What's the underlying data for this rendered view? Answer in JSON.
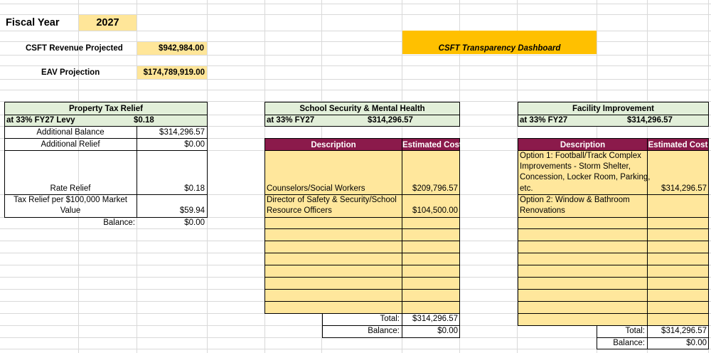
{
  "header": {
    "fiscal_year_label": "Fiscal Year",
    "fiscal_year_value": "2027",
    "revenue_label": "CSFT Revenue Projected",
    "revenue_value": "$942,984.00",
    "eav_label": "EAV Projection",
    "eav_value": "$174,789,919.00",
    "dashboard_title": "CSFT Transparency Dashboard"
  },
  "property_tax": {
    "title": "Property Tax Relief",
    "levy_label": "at 33% FY27 Levy",
    "levy_value": "$0.18",
    "additional_balance_label": "Additional Balance",
    "additional_balance_value": "$314,296.57",
    "additional_relief_label": "Additional Relief",
    "additional_relief_value": "$0.00",
    "rate_relief_label": "Rate Relief",
    "rate_relief_value": "$0.18",
    "tax_relief_label_1": "Tax Relief per $100,000 Market",
    "tax_relief_label_2": "Value",
    "tax_relief_value": "$59.94",
    "balance_label": "Balance:",
    "balance_value": "$0.00"
  },
  "security": {
    "title": "School Security & Mental Health",
    "levy_label": "at 33% FY27",
    "levy_value": "$314,296.57",
    "col_description": "Description",
    "col_cost": "Estimated Cost",
    "item1_desc": "Counselors/Social Workers",
    "item1_cost": "$209,796.57",
    "item2_desc_1": "Director of Safety & Security/School",
    "item2_desc_2": "Resource Officers",
    "item2_cost": "$104,500.00",
    "total_label": "Total:",
    "total_value": "$314,296.57",
    "balance_label": "Balance:",
    "balance_value": "$0.00"
  },
  "facility": {
    "title": "Facility Improvement",
    "levy_label": "at 33% FY27",
    "levy_value": "$314,296.57",
    "col_description": "Description",
    "col_cost": "Estimated Cost",
    "opt1_line1": "Option 1:  Football/Track Complex",
    "opt1_line2": "Improvements - Storm Shelter,",
    "opt1_line3": "Concession, Locker Room, Parking,",
    "opt1_line4": "etc.",
    "opt1_cost": "$314,296.57",
    "opt2_line1": "Option 2:  Window & Bathroom",
    "opt2_line2": "Renovations",
    "total_label": "Total:",
    "total_value": "$314,296.57",
    "balance_label": "Balance:",
    "balance_value": "$0.00"
  },
  "colors": {
    "yellow_input": "#ffe699",
    "green_header": "#e2efd9",
    "maroon_header": "#8b1a4b",
    "orange_banner": "#ffc000"
  }
}
